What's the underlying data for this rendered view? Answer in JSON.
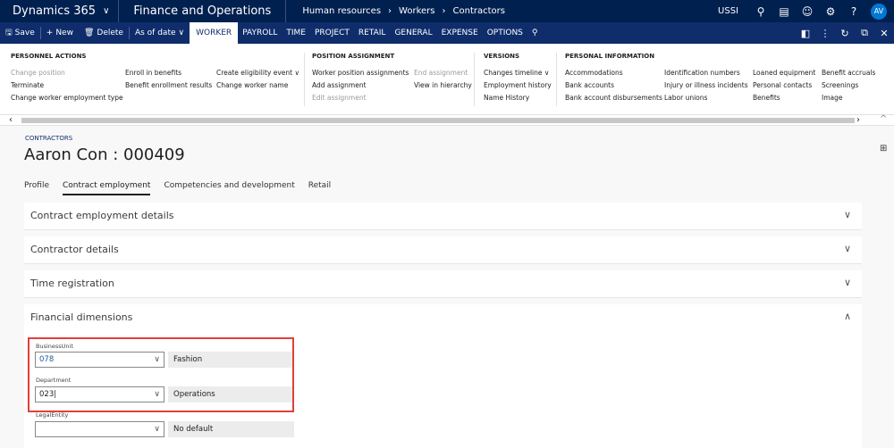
{
  "topbar": {
    "app_name": "Dynamics 365",
    "module": "Finance and Operations",
    "breadcrumb": [
      "Human resources",
      "Workers",
      "Contractors"
    ],
    "company": "USSI",
    "avatar_initials": "AV"
  },
  "actionbar": {
    "save": "Save",
    "new": "New",
    "delete": "Delete",
    "as_of_date": "As of date",
    "tabs": [
      "WORKER",
      "PAYROLL",
      "TIME",
      "PROJECT",
      "RETAIL",
      "GENERAL",
      "EXPENSE",
      "OPTIONS"
    ],
    "active_tab": "WORKER"
  },
  "ribbon": {
    "personnel_actions": {
      "heading": "PERSONNEL ACTIONS",
      "col1": [
        "Change position",
        "Terminate",
        "Change worker employment type"
      ],
      "col2": [
        "Enroll in benefits",
        "Benefit enrollment results"
      ],
      "col3": [
        "Create eligibility event",
        "Change worker name"
      ]
    },
    "position_assignment": {
      "heading": "POSITION ASSIGNMENT",
      "col1": [
        "Worker position assignments",
        "Add assignment",
        "Edit assignment"
      ],
      "col2": [
        "End assignment",
        "View in hierarchy"
      ]
    },
    "versions": {
      "heading": "VERSIONS",
      "col1": [
        "Changes timeline",
        "Employment history",
        "Name History"
      ]
    },
    "personal_information": {
      "heading": "PERSONAL INFORMATION",
      "col1": [
        "Accommodations",
        "Bank accounts",
        "Bank account disbursements"
      ],
      "col2": [
        "Identification numbers",
        "Injury or illness incidents",
        "Labor unions"
      ],
      "col3": [
        "Loaned equipment",
        "Personal contacts",
        "Benefits"
      ],
      "col4": [
        "Benefit accruals",
        "Screenings",
        "Image"
      ]
    }
  },
  "page": {
    "caption": "CONTRACTORS",
    "title": "Aaron Con : 000409",
    "tabs": [
      "Profile",
      "Contract employment",
      "Competencies and development",
      "Retail"
    ],
    "active_tab": "Contract employment"
  },
  "fasttabs": [
    {
      "label": "Contract employment details",
      "expanded": false
    },
    {
      "label": "Contractor details",
      "expanded": false
    },
    {
      "label": "Time registration",
      "expanded": false
    },
    {
      "label": "Financial dimensions",
      "expanded": true
    }
  ],
  "dimensions": [
    {
      "label": "BusinessUnit",
      "value": "078",
      "description": "Fashion"
    },
    {
      "label": "Department",
      "value": "023",
      "description": "Operations"
    },
    {
      "label": "LegalEntity",
      "value": "",
      "description": "No default"
    }
  ],
  "colors": {
    "topbar": "#002050",
    "actionbar": "#0f2d6b",
    "highlight": "#e0403a"
  }
}
